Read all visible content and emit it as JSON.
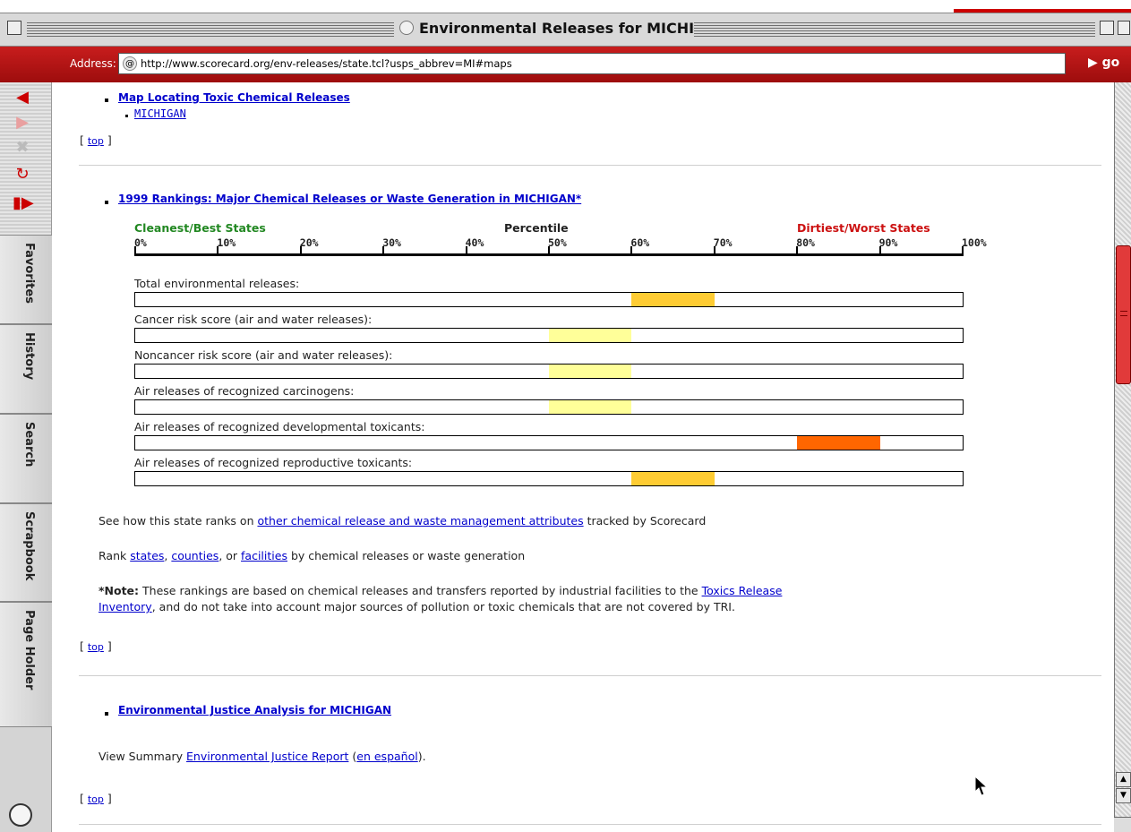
{
  "window": {
    "title": "Environmental Releases for MICHIGAN"
  },
  "address_bar": {
    "label": "Address:",
    "url": "http://www.scorecard.org/env-releases/state.tcl?usps_abbrev=MI#maps",
    "go_label": "go"
  },
  "sidebar": {
    "tabs": [
      "Favorites",
      "History",
      "Search",
      "Scrapbook",
      "Page Holder"
    ]
  },
  "page": {
    "map_section": {
      "heading": "Map Locating Toxic Chemical Releases",
      "sub_link": "MICHIGAN",
      "top_link": "top"
    },
    "rankings": {
      "heading": "1999 Rankings: Major Chemical Releases or Waste Generation in MICHIGAN*",
      "left_caption": "Cleanest/Best States",
      "center_caption": "Percentile",
      "right_caption": "Dirtiest/Worst States",
      "percent_ticks": [
        "0%",
        "10%",
        "20%",
        "30%",
        "40%",
        "50%",
        "60%",
        "70%",
        "80%",
        "90%",
        "100%"
      ],
      "see_how_prefix": "See how this state ranks on ",
      "see_how_link": "other chemical release and waste management attributes",
      "see_how_suffix": " tracked by Scorecard",
      "rank_prefix": "Rank ",
      "rank_link_states": "states",
      "rank_sep1": ", ",
      "rank_link_counties": "counties",
      "rank_sep2": ", or ",
      "rank_link_facilities": "facilities",
      "rank_suffix": " by chemical releases or waste generation",
      "note_bold": "*Note:",
      "note_text1": " These rankings are based on chemical releases and transfers reported by industrial facilities to the ",
      "note_link1": "Toxics Release",
      "note_link2": "Inventory",
      "note_text2": ", and do not take into account major sources of pollution or toxic chemicals that are not covered by TRI.",
      "top_link": "top"
    },
    "ej_section": {
      "heading": "Environmental Justice Analysis for MICHIGAN",
      "view_prefix": "View Summary ",
      "view_link": "Environmental Justice Report",
      "paren_open": " (",
      "espanol_link": "en español",
      "paren_close": ").",
      "top_link": "top"
    }
  },
  "chart_data": {
    "type": "bar",
    "title": "1999 Rankings: Major Chemical Releases or Waste Generation in MICHIGAN*",
    "xlabel": "Percentile",
    "xlim": [
      0,
      100
    ],
    "categories": [
      "Total environmental releases:",
      "Cancer risk score (air and water releases):",
      "Noncancer risk score (air and water releases):",
      "Air releases of recognized carcinogens:",
      "Air releases of recognized developmental toxicants:",
      "Air releases of recognized reproductive toxicants:"
    ],
    "ranges": [
      [
        60,
        70
      ],
      [
        50,
        60
      ],
      [
        50,
        60
      ],
      [
        50,
        60
      ],
      [
        80,
        90
      ],
      [
        60,
        70
      ]
    ],
    "colors": [
      "#ffcc33",
      "#ffff99",
      "#ffff99",
      "#ffff99",
      "#ff6600",
      "#ffcc33"
    ]
  }
}
